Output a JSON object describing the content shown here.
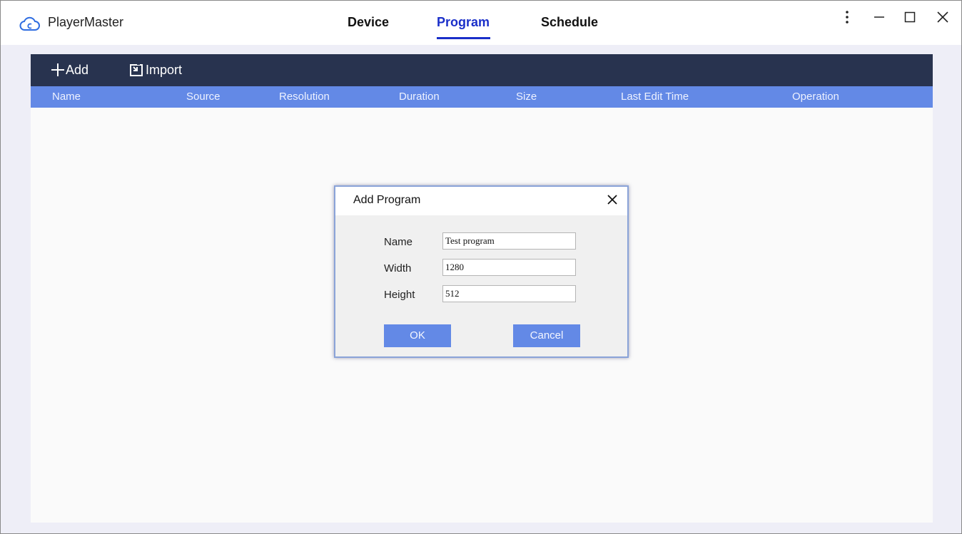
{
  "app": {
    "title": "PlayerMaster",
    "logo_icon": "cloud-logo-icon",
    "accent_color": "#1a2fc9"
  },
  "nav": {
    "tabs": [
      {
        "label": "Device",
        "active": false
      },
      {
        "label": "Program",
        "active": true
      },
      {
        "label": "Schedule",
        "active": false
      }
    ]
  },
  "window_controls": [
    "more-vertical-icon",
    "minimize-icon",
    "maximize-icon",
    "close-icon"
  ],
  "toolbar": {
    "add_label": "Add",
    "import_label": "Import"
  },
  "table": {
    "columns": [
      "Name",
      "Source",
      "Resolution",
      "Duration",
      "Size",
      "Last Edit Time",
      "Operation"
    ],
    "header_color": "#6389e6",
    "toolbar_color": "#28334f"
  },
  "dialog": {
    "title": "Add Program",
    "fields": [
      {
        "label": "Name",
        "value": "Test program"
      },
      {
        "label": "Width",
        "value": "1280"
      },
      {
        "label": "Height",
        "value": "512"
      }
    ],
    "ok_label": "OK",
    "cancel_label": "Cancel"
  }
}
